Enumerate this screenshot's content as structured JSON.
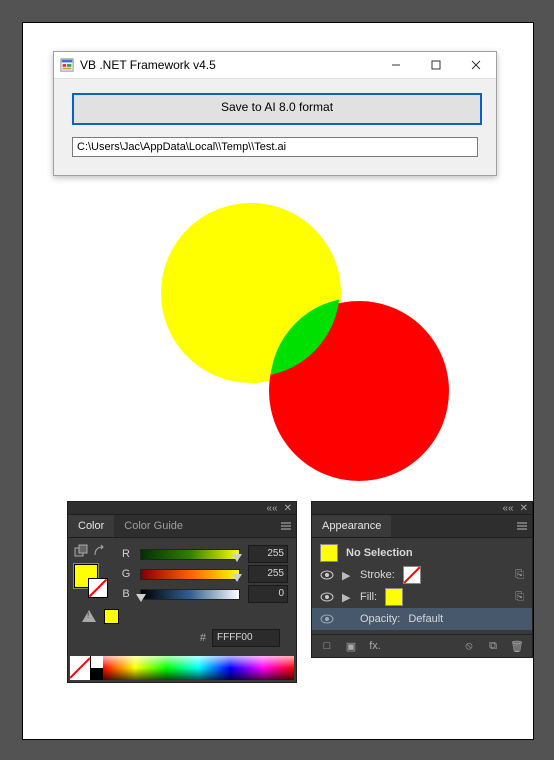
{
  "dialog": {
    "title": "VB .NET Framework v4.5",
    "save_label": "Save to AI 8.0 format",
    "path_value": "C:\\Users\\Jac\\AppData\\Local\\\\Temp\\\\Test.ai"
  },
  "color_panel": {
    "tab_color": "Color",
    "tab_guide": "Color Guide",
    "r_label": "R",
    "g_label": "G",
    "b_label": "B",
    "r_value": "255",
    "g_value": "255",
    "b_value": "0",
    "hex_value": "FFFF00"
  },
  "appearance_panel": {
    "tab": "Appearance",
    "no_selection": "No Selection",
    "stroke_label": "Stroke:",
    "fill_label": "Fill:",
    "opacity_label": "Opacity:",
    "opacity_value": "Default",
    "fx_label": "fx."
  }
}
